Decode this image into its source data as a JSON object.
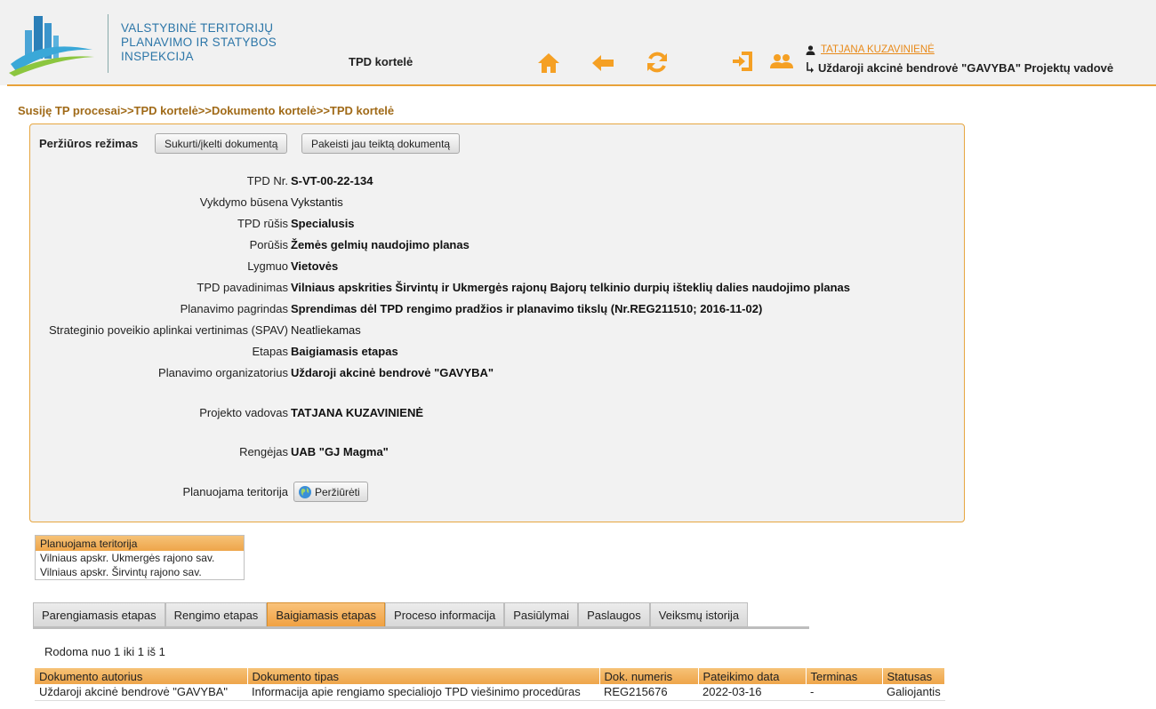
{
  "header": {
    "org_line1": "VALSTYBINĖ TERITORIJŲ",
    "org_line2": "PLANAVIMO IR STATYBOS",
    "org_line3": "INSPEKCIJA",
    "page_label": "TPD kortelė",
    "user_name": "TATJANA KUZAVINIENĖ",
    "role": "Uždaroji akcinė bendrovė \"GAVYBA\" Projektų vadovė",
    "icons": [
      "home-icon",
      "back-arrow-icon",
      "refresh-icon",
      "logout-icon",
      "users-icon"
    ],
    "accent": "#f5a024"
  },
  "breadcrumb": "Susiję TP procesai>>TPD kortelė>>Dokumento kortelė>>TPD kortelė",
  "card": {
    "mode": "Peržiūros režimas",
    "create_button": "Sukurti/įkelti dokumentą",
    "replace_button": "Pakeisti jau teiktą dokumentą",
    "fields": [
      {
        "label": "TPD Nr.",
        "value": "S-VT-00-22-134"
      },
      {
        "label": "Vykdymo būsena",
        "value": "Vykstantis"
      },
      {
        "label": "TPD rūšis",
        "value": "Specialusis"
      },
      {
        "label": "Porūšis",
        "value": "Žemės gelmių naudojimo planas"
      },
      {
        "label": "Lygmuo",
        "value": "Vietovės"
      },
      {
        "label": "TPD pavadinimas",
        "value": "Vilniaus apskrities Širvintų ir Ukmergės rajonų Bajorų telkinio durpių išteklių dalies naudojimo planas"
      },
      {
        "label": "Planavimo pagrindas",
        "value": "Sprendimas dėl TPD rengimo pradžios ir planavimo tikslų (Nr.REG211510; 2016-11-02)"
      },
      {
        "label": "Strateginio poveikio aplinkai vertinimas (SPAV)",
        "value": "Neatliekamas"
      },
      {
        "label": "Etapas",
        "value": "Baigiamasis etapas"
      },
      {
        "label": "Planavimo organizatorius",
        "value": "Uždaroji akcinė bendrovė \"GAVYBA\""
      },
      {
        "label": "Projekto vadovas",
        "value": "TATJANA KUZAVINIENĖ"
      },
      {
        "label": "Rengėjas",
        "value": "UAB \"GJ Magma\""
      }
    ],
    "territory_label": "Planuojama teritorija",
    "view_button": "Peržiūrėti"
  },
  "territory_table": {
    "header": "Planuojama teritorija",
    "rows": [
      "Vilniaus apskr. Ukmergės rajono sav.",
      "Vilniaus apskr. Širvintų rajono sav."
    ]
  },
  "tabs": [
    {
      "label": "Parengiamasis etapas",
      "active": false
    },
    {
      "label": "Rengimo etapas",
      "active": false
    },
    {
      "label": "Baigiamasis etapas",
      "active": true
    },
    {
      "label": "Proceso informacija",
      "active": false
    },
    {
      "label": "Pasiūlymai",
      "active": false
    },
    {
      "label": "Paslaugos",
      "active": false
    },
    {
      "label": "Veiksmų istorija",
      "active": false
    }
  ],
  "records_text": "Rodoma nuo 1 iki 1 iš 1",
  "documents": {
    "columns": [
      "Dokumento autorius",
      "Dokumento tipas",
      "Dok. numeris",
      "Pateikimo data",
      "Terminas",
      "Statusas"
    ],
    "rows": [
      [
        "Uždaroji akcinė bendrovė \"GAVYBA\"",
        "Informacija apie rengiamo specialiojo TPD viešinimo procedūras",
        "REG215676",
        "2022-03-16",
        "-",
        "Galiojantis"
      ]
    ]
  }
}
